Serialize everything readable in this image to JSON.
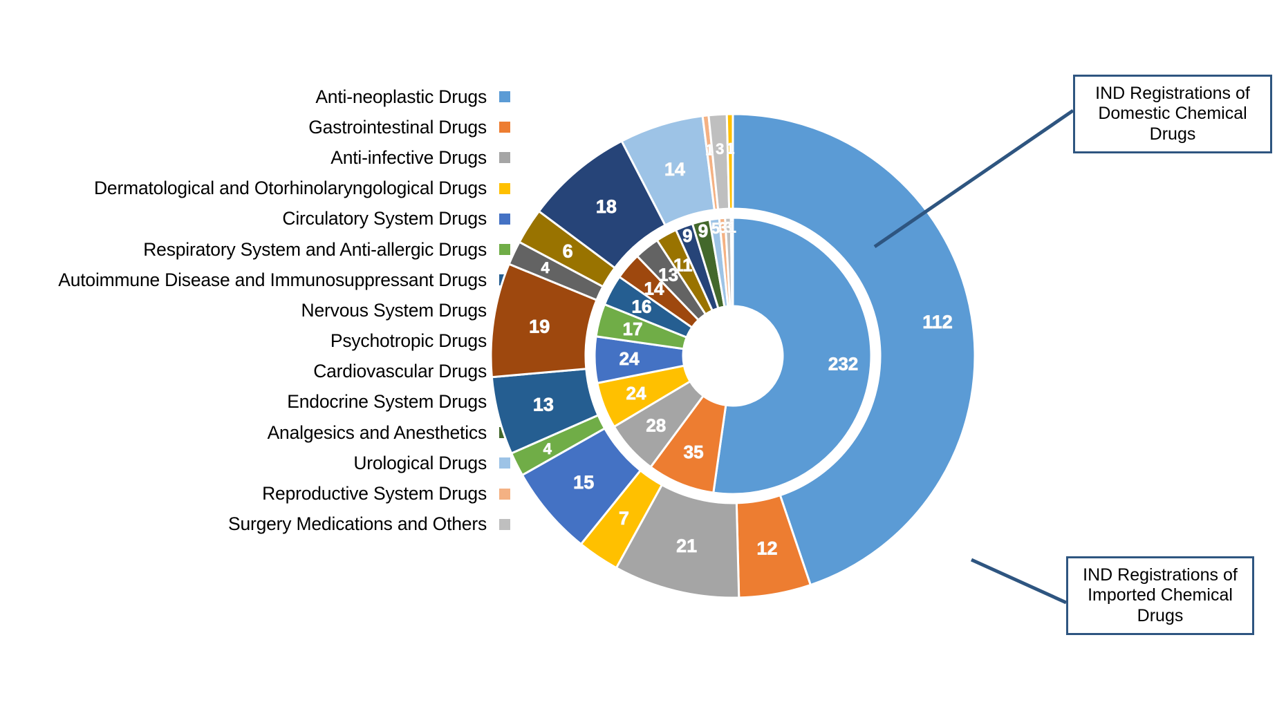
{
  "legend": {
    "items": [
      {
        "label": "Anti-neoplastic Drugs",
        "color": "#5B9BD5"
      },
      {
        "label": "Gastrointestinal Drugs",
        "color": "#ED7D31"
      },
      {
        "label": "Anti-infective Drugs",
        "color": "#A5A5A5"
      },
      {
        "label": "Dermatological and Otorhinolaryngological Drugs",
        "color": "#FFC000"
      },
      {
        "label": "Circulatory System Drugs",
        "color": "#4472C4"
      },
      {
        "label": "Respiratory System and Anti-allergic Drugs",
        "color": "#70AD47"
      },
      {
        "label": "Autoimmune Disease and Immunosuppressant Drugs",
        "color": "#255E91"
      },
      {
        "label": "Nervous System Drugs",
        "color": "#9E480E"
      },
      {
        "label": "Psychotropic Drugs",
        "color": "#636363"
      },
      {
        "label": "Cardiovascular Drugs",
        "color": "#997300"
      },
      {
        "label": "Endocrine System Drugs",
        "color": "#264478"
      },
      {
        "label": "Analgesics and Anesthetics",
        "color": "#43682B"
      },
      {
        "label": "Urological Drugs",
        "color": "#9DC3E6"
      },
      {
        "label": "Reproductive System Drugs",
        "color": "#F4B183"
      },
      {
        "label": "Surgery Medications and Others",
        "color": "#BFBFBF"
      }
    ]
  },
  "callouts": {
    "domestic": "IND Registrations of Domestic Chemical Drugs",
    "imported": "IND Registrations of Imported Chemical Drugs",
    "border_color": "#2E5580"
  },
  "chart_data": {
    "type": "pie",
    "title": "",
    "variant": "nested-donut",
    "legend_position": "left",
    "rings": [
      {
        "name": "IND Registrations of Domestic Chemical Drugs",
        "ring": "inner",
        "total": 232,
        "categories": [
          "Anti-neoplastic Drugs",
          "Gastrointestinal Drugs",
          "Anti-infective Drugs",
          "Dermatological and Otorhinolaryngological Drugs",
          "Circulatory System Drugs",
          "Respiratory System and Anti-allergic Drugs",
          "Autoimmune Disease and Immunosuppressant Drugs",
          "Nervous System Drugs",
          "Psychotropic Drugs",
          "Cardiovascular Drugs",
          "Endocrine System Drugs",
          "Analgesics and Anesthetics",
          "Urological Drugs",
          "Reproductive System Drugs",
          "Surgery Medications and Others"
        ],
        "values": [
          232,
          35,
          28,
          24,
          24,
          17,
          16,
          14,
          13,
          11,
          9,
          9,
          5,
          3,
          3
        ],
        "slices": [
          {
            "label": "Anti-neoplastic Drugs",
            "value": 232,
            "color": "#5B9BD5"
          },
          {
            "label": "Gastrointestinal Drugs",
            "value": 35,
            "color": "#ED7D31"
          },
          {
            "label": "Anti-infective Drugs",
            "value": 28,
            "color": "#A5A5A5"
          },
          {
            "label": "Dermatological and Otorhinolaryngological Drugs",
            "value": 24,
            "color": "#FFC000"
          },
          {
            "label": "Circulatory System Drugs",
            "value": 24,
            "color": "#4472C4"
          },
          {
            "label": "Respiratory System and Anti-allergic Drugs",
            "value": 17,
            "color": "#70AD47"
          },
          {
            "label": "Autoimmune Disease and Immunosuppressant Drugs",
            "value": 16,
            "color": "#255E91"
          },
          {
            "label": "Nervous System Drugs",
            "value": 14,
            "color": "#9E480E"
          },
          {
            "label": "Psychotropic Drugs",
            "value": 13,
            "color": "#636363"
          },
          {
            "label": "Cardiovascular Drugs",
            "value": 11,
            "color": "#997300"
          },
          {
            "label": "Endocrine System Drugs",
            "value": 9,
            "color": "#264478"
          },
          {
            "label": "Analgesics and Anesthetics",
            "value": 9,
            "color": "#43682B"
          },
          {
            "label": "Urological Drugs",
            "value": 5,
            "color": "#9DC3E6"
          },
          {
            "label": "Reproductive System Drugs",
            "value": 3,
            "color": "#F4B183"
          },
          {
            "label": "Surgery Medications and Others",
            "value": 3,
            "color": "#BFBFBF"
          },
          {
            "label": "Dermatological and Otorhinolaryngological Drugs",
            "value": 1,
            "color": "#FFC000"
          }
        ]
      },
      {
        "name": "IND Registrations of Imported Chemical Drugs",
        "ring": "outer",
        "total": 112,
        "slices": [
          {
            "label": "Anti-neoplastic Drugs",
            "value": 112,
            "color": "#5B9BD5"
          },
          {
            "label": "Gastrointestinal Drugs",
            "value": 12,
            "color": "#ED7D31"
          },
          {
            "label": "Anti-infective Drugs",
            "value": 21,
            "color": "#A5A5A5"
          },
          {
            "label": "Dermatological and Otorhinolaryngological Drugs",
            "value": 7,
            "color": "#FFC000"
          },
          {
            "label": "Circulatory System Drugs",
            "value": 15,
            "color": "#4472C4"
          },
          {
            "label": "Respiratory System and Anti-allergic Drugs",
            "value": 4,
            "color": "#70AD47"
          },
          {
            "label": "Autoimmune Disease and Immunosuppressant Drugs",
            "value": 13,
            "color": "#255E91"
          },
          {
            "label": "Nervous System Drugs",
            "value": 19,
            "color": "#9E480E"
          },
          {
            "label": "Psychotropic Drugs",
            "value": 4,
            "color": "#636363"
          },
          {
            "label": "Cardiovascular Drugs",
            "value": 6,
            "color": "#997300"
          },
          {
            "label": "Endocrine System Drugs",
            "value": 18,
            "color": "#264478"
          },
          {
            "label": "Urological Drugs",
            "value": 14,
            "color": "#9DC3E6"
          },
          {
            "label": "Reproductive System Drugs",
            "value": 1,
            "color": "#F4B183"
          },
          {
            "label": "Surgery Medications and Others",
            "value": 3,
            "color": "#BFBFBF"
          },
          {
            "label": "Dermatological and Otorhinolaryngological Drugs",
            "value": 1,
            "color": "#FFC000"
          }
        ]
      }
    ]
  }
}
